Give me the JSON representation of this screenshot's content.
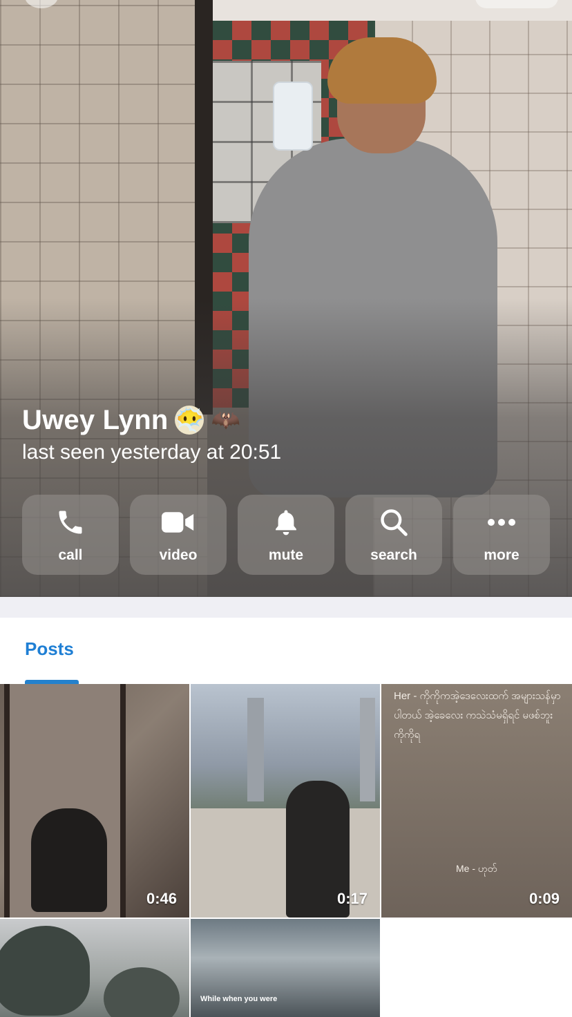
{
  "profile": {
    "name": "Uwey Lynn",
    "emoji_status_1": "😶‍🌫️",
    "emoji_status_2": "🦇",
    "last_seen": "last seen yesterday at 20:51"
  },
  "actions": [
    {
      "label": "call",
      "icon": "phone-icon"
    },
    {
      "label": "video",
      "icon": "video-camera-icon"
    },
    {
      "label": "mute",
      "icon": "bell-icon"
    },
    {
      "label": "search",
      "icon": "search-icon"
    },
    {
      "label": "more",
      "icon": "ellipsis-icon"
    }
  ],
  "tabs": {
    "posts_label": "Posts"
  },
  "posts": [
    {
      "duration": "0:46"
    },
    {
      "duration": "0:17"
    },
    {
      "duration": "0:09",
      "text_top": "Her - ကိုကိုကအဲ့ဒေလေးထက် အများသန်မှာပါတယ် အဲ့ခေလေး ကသဲသံမရှိရင် မဖစ်ဘူး ကိုကိုရ",
      "text_bottom": "Me - ဟုတ်"
    },
    {
      "duration": ""
    },
    {
      "duration": "",
      "text_top": "While when you were"
    }
  ],
  "colors": {
    "accent": "#2481cc",
    "tab_text": "#1f7fd4",
    "separator": "#efeff4",
    "button_bg": "rgba(150,145,142,0.55)"
  }
}
